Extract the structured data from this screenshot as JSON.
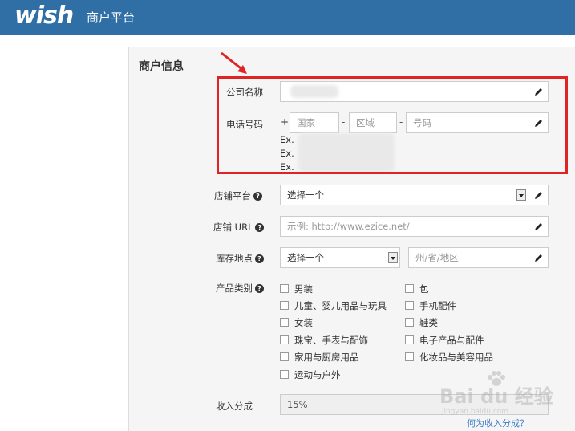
{
  "header": {
    "logo_text": "wish",
    "portal_title": "商户平台",
    "bg_color": "#2f6fa5"
  },
  "section": {
    "title": "商户信息"
  },
  "form": {
    "company_name": {
      "label": "公司名称",
      "value": ""
    },
    "phone": {
      "label": "电话号码",
      "plus": "+",
      "country_placeholder": "国家",
      "area_placeholder": "区域",
      "number_placeholder": "号码",
      "examples": [
        "Ex.",
        "Ex.",
        "Ex."
      ]
    },
    "store_platform": {
      "label": "店铺平台",
      "selected": "选择一个"
    },
    "store_url": {
      "label": "店铺 URL",
      "placeholder": "示例: http://www.ezice.net/"
    },
    "warehouse": {
      "label": "库存地点",
      "selected": "选择一个",
      "region_placeholder": "州/省/地区"
    },
    "categories": {
      "label": "产品类别",
      "left": [
        "男装",
        "儿童、婴儿用品与玩具",
        "女装",
        "珠宝、手表与配饰",
        "家用与厨房用品",
        "运动与户外"
      ],
      "right": [
        "包",
        "手机配件",
        "鞋类",
        "电子产品与配件",
        "化妆品与美容用品"
      ]
    },
    "revenue_share": {
      "label": "收入分成",
      "value": "15%",
      "help_link": "何为收入分成？"
    }
  },
  "watermark": {
    "main": "Bai du 经验",
    "sub": "jingyan.baidu.com"
  },
  "annotation_color": "#e02424"
}
